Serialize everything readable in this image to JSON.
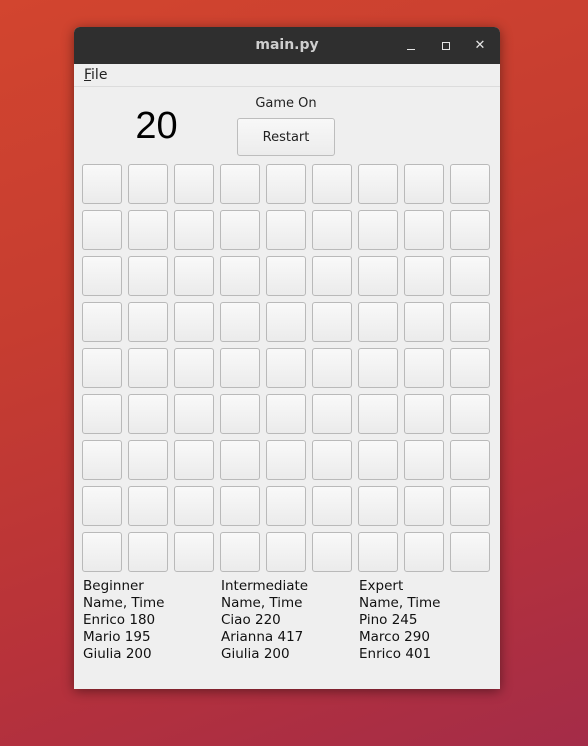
{
  "window": {
    "title": "main.py"
  },
  "window_controls": {
    "minimize": "",
    "maximize": "",
    "close": "✕"
  },
  "menu": {
    "file_first": "F",
    "file_rest": "ile"
  },
  "game": {
    "counter": "20",
    "status": "Game On",
    "restart_label": "Restart",
    "rows": 9,
    "cols": 9
  },
  "scores": [
    {
      "level": "Beginner",
      "header": "Name, Time",
      "entries": [
        "Enrico 180",
        "Mario 195",
        "Giulia 200"
      ]
    },
    {
      "level": "Intermediate",
      "header": "Name, Time",
      "entries": [
        "Ciao 220",
        "Arianna 417",
        "Giulia 200"
      ]
    },
    {
      "level": "Expert",
      "header": "Name, Time",
      "entries": [
        "Pino 245",
        "Marco 290",
        "Enrico 401"
      ]
    }
  ]
}
